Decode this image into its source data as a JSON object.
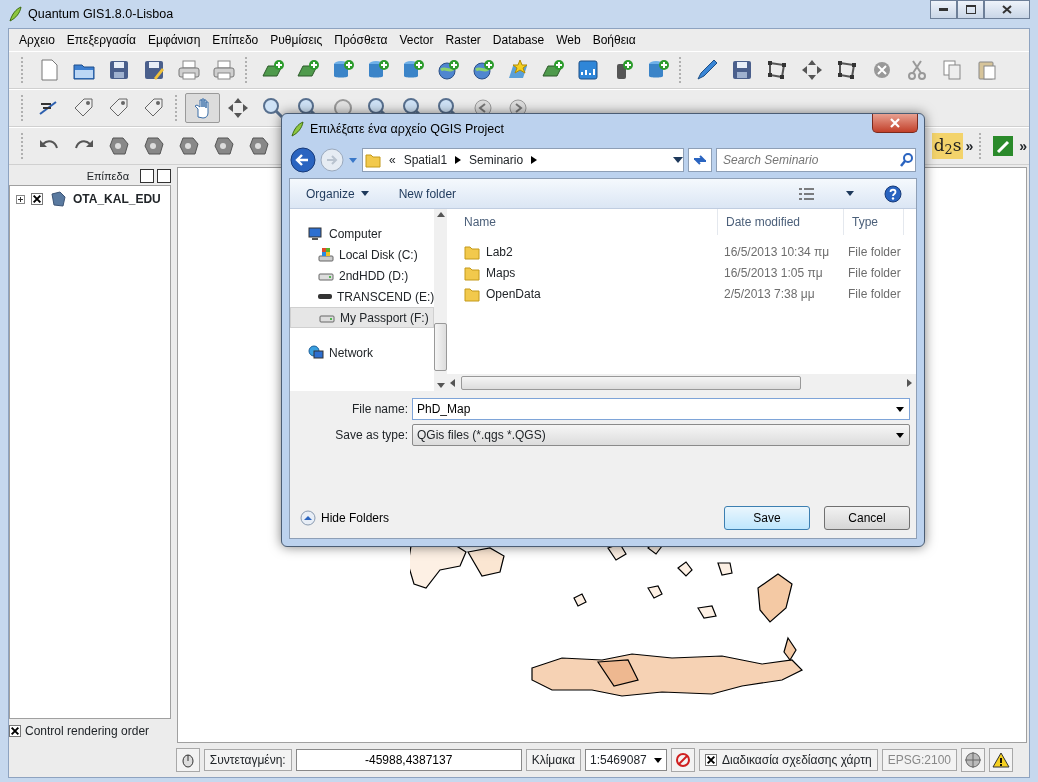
{
  "window": {
    "title": "Quantum GIS1.8.0-Lisboa"
  },
  "menu": [
    "Αρχειο",
    "Επεξεργασία",
    "Εμφάνιση",
    "Επίπεδο",
    "Ρυθμίσεις",
    "Πρόσθετα",
    "Vector",
    "Raster",
    "Database",
    "Web",
    "Βοήθεια"
  ],
  "toolbar_3": {
    "plugin_label": "d$_{2}$s",
    "overflow": [
      "»",
      "»"
    ]
  },
  "layers_panel": {
    "title": "Επίπεδα",
    "layers": [
      {
        "name": "OTA_KAL_EDU",
        "visible": true
      }
    ],
    "control_rendering_order": {
      "label": "Control rendering order",
      "checked": true
    }
  },
  "status_bar": {
    "coordinate_label": "Συντεταγμένη:",
    "coordinate": "-45988,4387137",
    "scale_label": "Κλίμακα",
    "scale": "1:5469087",
    "render": {
      "label": "Διαδικασία σχεδίασης χάρτη",
      "checked": true
    },
    "crs": "EPSG:2100"
  },
  "dialog": {
    "title": "Επιλέξατε ένα αρχείο QGIS Project",
    "breadcrumb_prefix": "«",
    "breadcrumb": [
      "Spatial1",
      "Seminario"
    ],
    "search": {
      "placeholder": "Search Seminario"
    },
    "toolbar": [
      "Organize",
      "New folder"
    ],
    "nav": [
      {
        "label": "Computer",
        "kind": "computer",
        "selected": false,
        "children": [
          {
            "label": "Local Disk (C:)",
            "kind": "system-drive",
            "selected": false
          },
          {
            "label": "2ndHDD (D:)",
            "kind": "drive",
            "selected": false
          },
          {
            "label": "TRANSCEND (E:)",
            "kind": "usb-drive",
            "selected": false
          },
          {
            "label": "My Passport (F:)",
            "kind": "drive",
            "selected": true
          }
        ]
      },
      {
        "label": "Network",
        "kind": "network",
        "selected": false
      }
    ],
    "columns": [
      "Name",
      "Date modified",
      "Type"
    ],
    "rows": [
      {
        "name": "Lab2",
        "date": "16/5/2013 10:34 πμ",
        "type": "File folder",
        "selected": false
      },
      {
        "name": "Maps",
        "date": "16/5/2013 1:05 πμ",
        "type": "File folder",
        "selected": false
      },
      {
        "name": "OpenData",
        "date": "2/5/2013 7:38 μμ",
        "type": "File folder",
        "selected": false
      }
    ],
    "file_name": {
      "label": "File name:",
      "value": "PhD_Map"
    },
    "save_as_type": {
      "label": "Save as type:",
      "value": "QGis files (*.qgs *.QGS)"
    },
    "hide_folders": "Hide Folders",
    "buttons": [
      {
        "label": "Save",
        "kind": "default"
      },
      {
        "label": "Cancel",
        "kind": "normal"
      }
    ]
  }
}
